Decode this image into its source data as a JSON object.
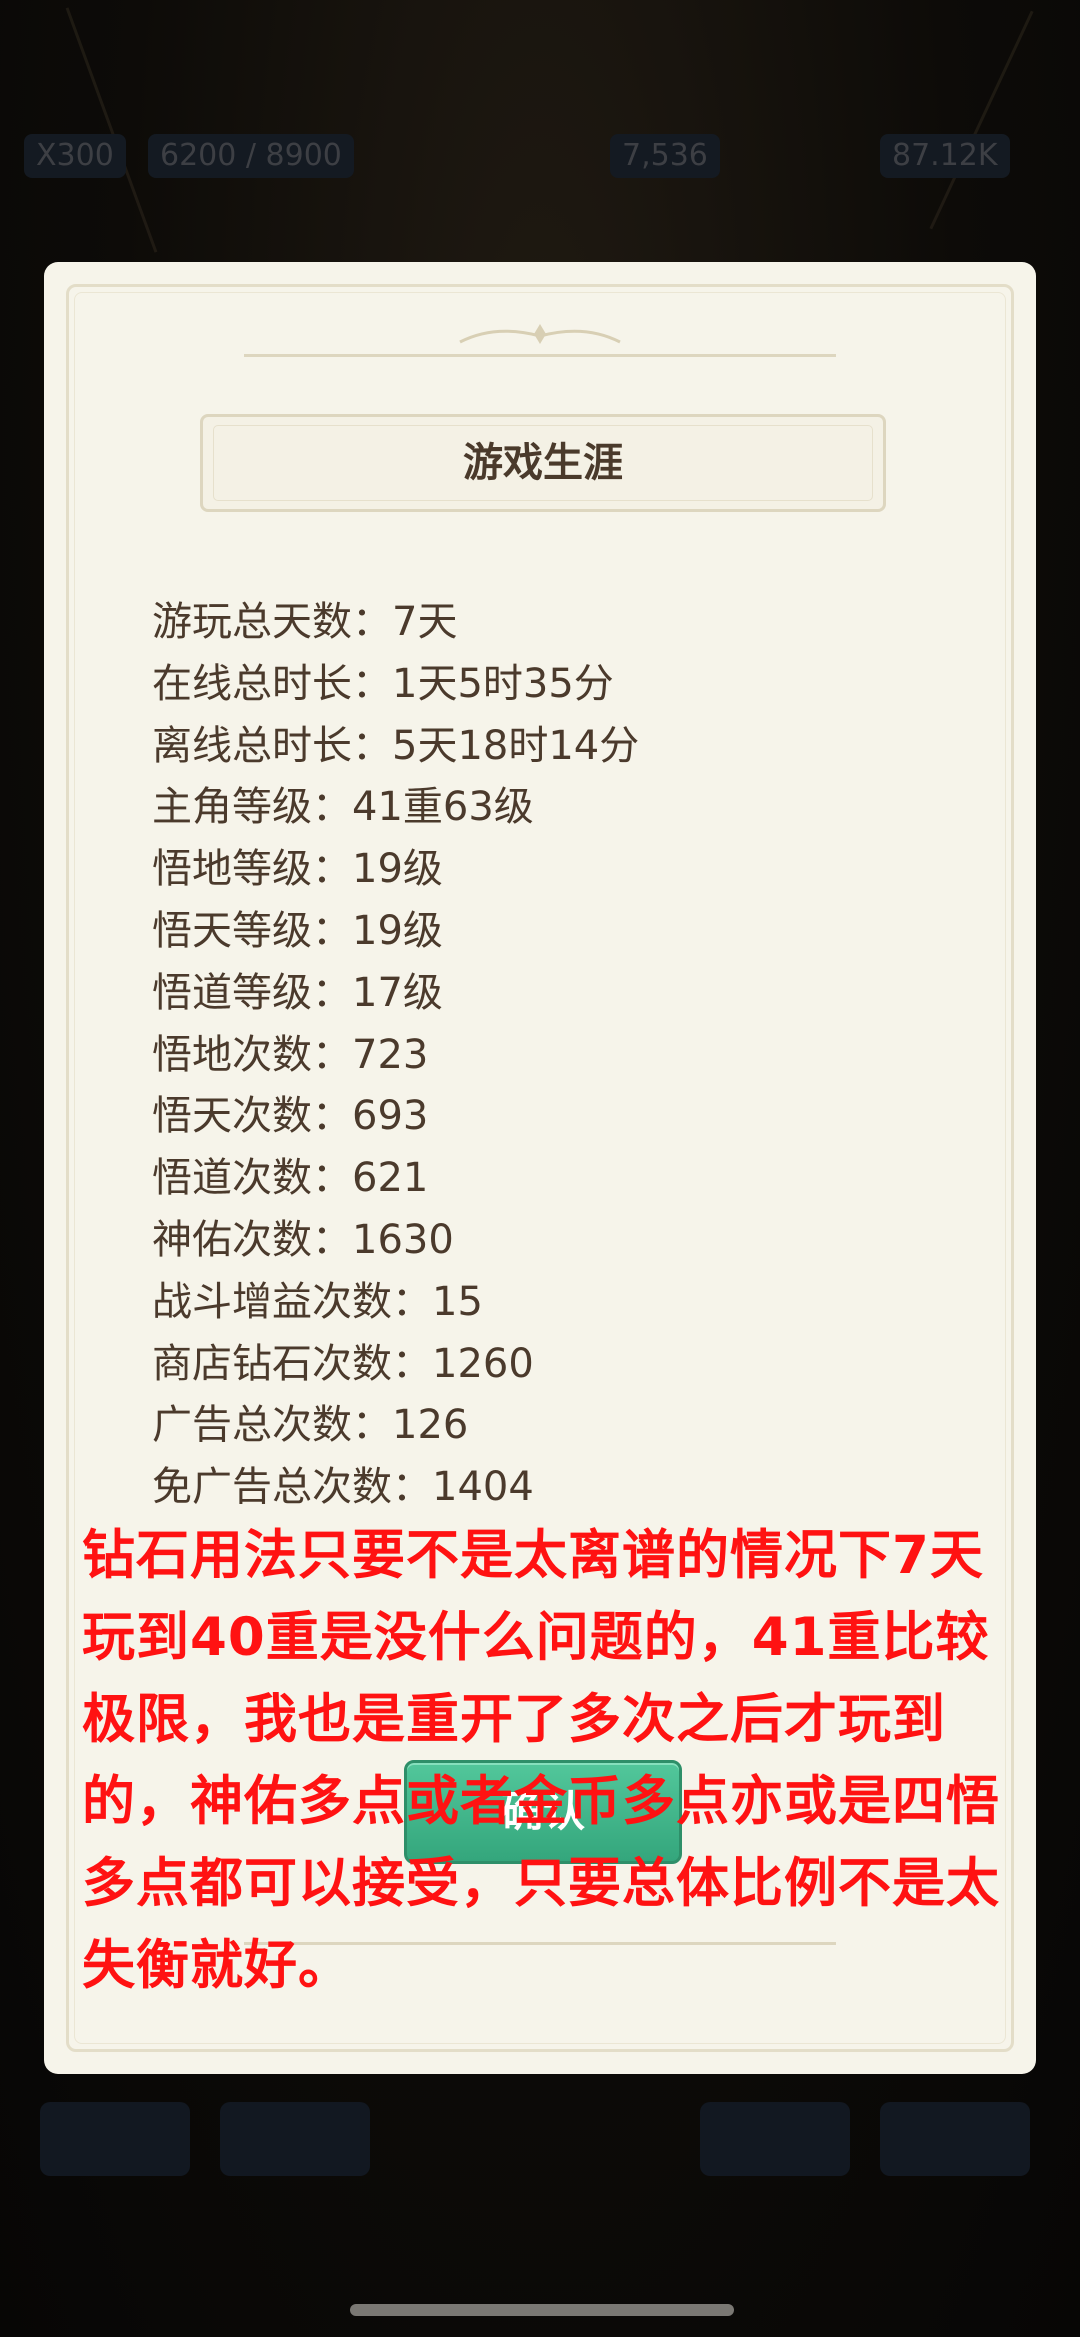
{
  "hud": {
    "level_badge": "X300",
    "progress_text": "6200 / 8900",
    "currency_1": "7,536",
    "currency_2": "87.12K"
  },
  "dialog": {
    "title": "游戏生涯",
    "stats": [
      "游玩总天数：7天",
      "在线总时长：1天5时35分",
      "离线总时长：5天18时14分",
      "主角等级：41重63级",
      "悟地等级：19级",
      "悟天等级：19级",
      "悟道等级：17级",
      "悟地次数：723",
      "悟天次数：693",
      "悟道次数：621",
      "神佑次数：1630",
      "战斗增益次数：15",
      "商店钻石次数：1260",
      "广告总次数：126",
      "免广告总次数：1404"
    ],
    "confirm_label": "确认"
  },
  "overlay_text": "钻石用法只要不是太离谱的情况下7天玩到40重是没什么问题的，41重比较极限，我也是重开了多次之后才玩到的，神佑多点或者金币多点亦或是四悟多点都可以接受，只要总体比例不是太失衡就好。",
  "colors": {
    "dialog_bg": "#f6f4ea",
    "title_text": "#4a3a2b",
    "stat_text": "#4b3a2c",
    "confirm_button": "#45b98c",
    "overlay_text": "#ff1212"
  }
}
